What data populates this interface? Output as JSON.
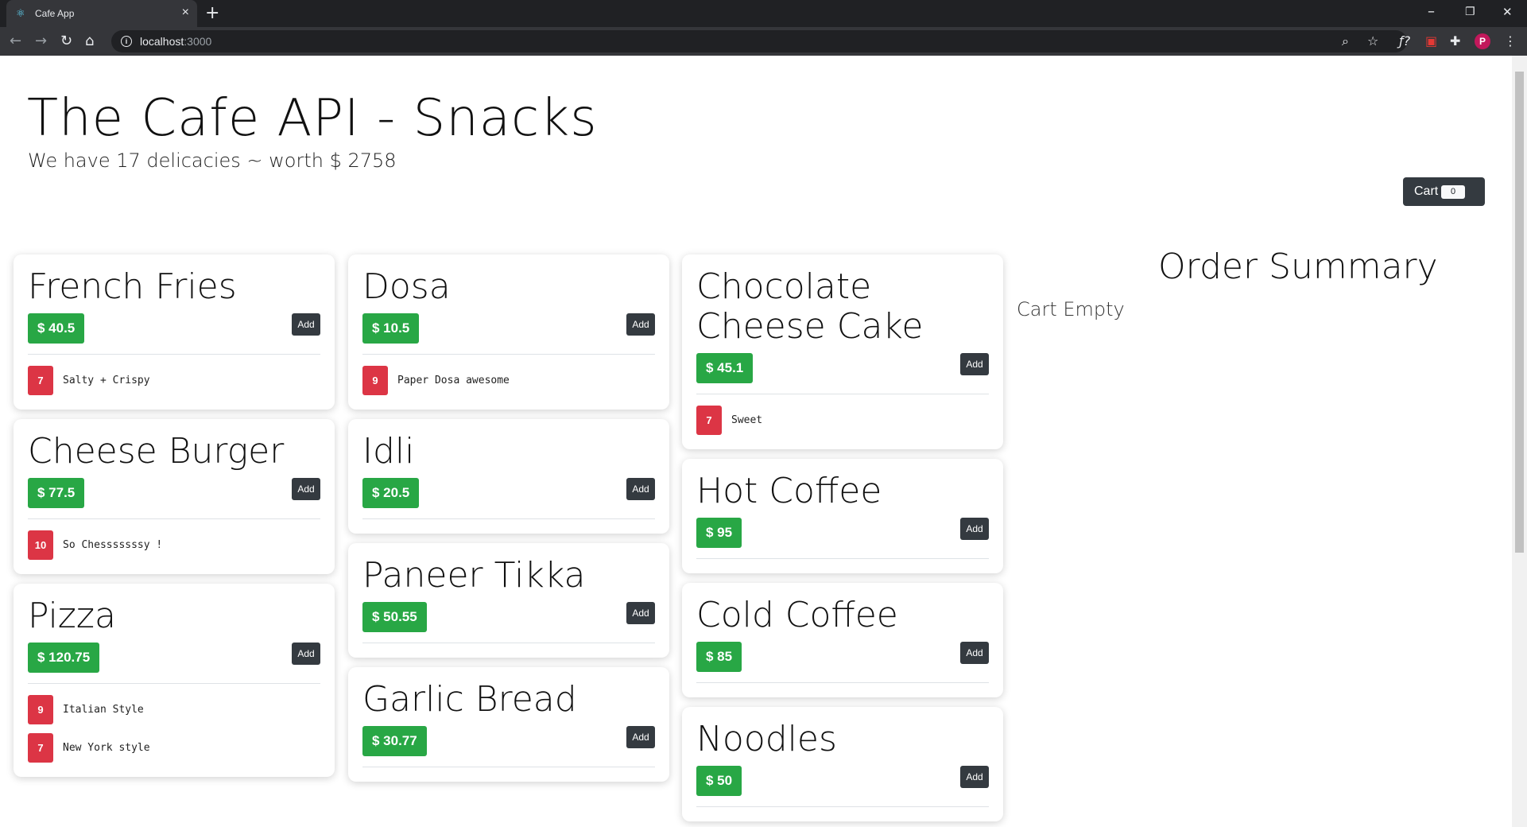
{
  "browser": {
    "tab_title": "Cafe App",
    "url_host": "localhost",
    "url_port": ":3000",
    "new_tab_symbol": "+",
    "close_tab_symbol": "×",
    "window_controls": [
      "–",
      "❐",
      "✕"
    ]
  },
  "header": {
    "title": "The Cafe API - Snacks",
    "subtitle": "We have 17 delicacies ~ worth $ 2758"
  },
  "cart": {
    "label": "Cart",
    "count": "0"
  },
  "summary": {
    "title": "Order Summary",
    "empty_text": "Cart Empty"
  },
  "add_label": "Add",
  "columns": [
    [
      {
        "name": "French Fries",
        "price": "$ 40.5",
        "tags": [
          {
            "num": "7",
            "text": "Salty + Crispy"
          }
        ]
      },
      {
        "name": "Cheese Burger",
        "price": "$ 77.5",
        "tags": [
          {
            "num": "10",
            "text": "So Chesssssssy !"
          }
        ]
      },
      {
        "name": "Pizza",
        "price": "$ 120.75",
        "tags": [
          {
            "num": "9",
            "text": "Italian Style"
          },
          {
            "num": "7",
            "text": "New York style"
          }
        ]
      }
    ],
    [
      {
        "name": "Dosa",
        "price": "$ 10.5",
        "tags": [
          {
            "num": "9",
            "text": "Paper Dosa awesome"
          }
        ]
      },
      {
        "name": "Idli",
        "price": "$ 20.5",
        "tags": []
      },
      {
        "name": "Paneer Tikka",
        "price": "$ 50.55",
        "tags": []
      },
      {
        "name": "Garlic Bread",
        "price": "$ 30.77",
        "tags": []
      }
    ],
    [
      {
        "name": "Chocolate Cheese Cake",
        "price": "$ 45.1",
        "tags": [
          {
            "num": "7",
            "text": "Sweet"
          }
        ]
      },
      {
        "name": "Hot Coffee",
        "price": "$ 95",
        "tags": []
      },
      {
        "name": "Cold Coffee",
        "price": "$ 85",
        "tags": []
      },
      {
        "name": "Noodles",
        "price": "$ 50",
        "tags": []
      }
    ]
  ],
  "colors": {
    "price_green": "#28a745",
    "tag_red": "#dc3545",
    "dark_button": "#343a40"
  }
}
